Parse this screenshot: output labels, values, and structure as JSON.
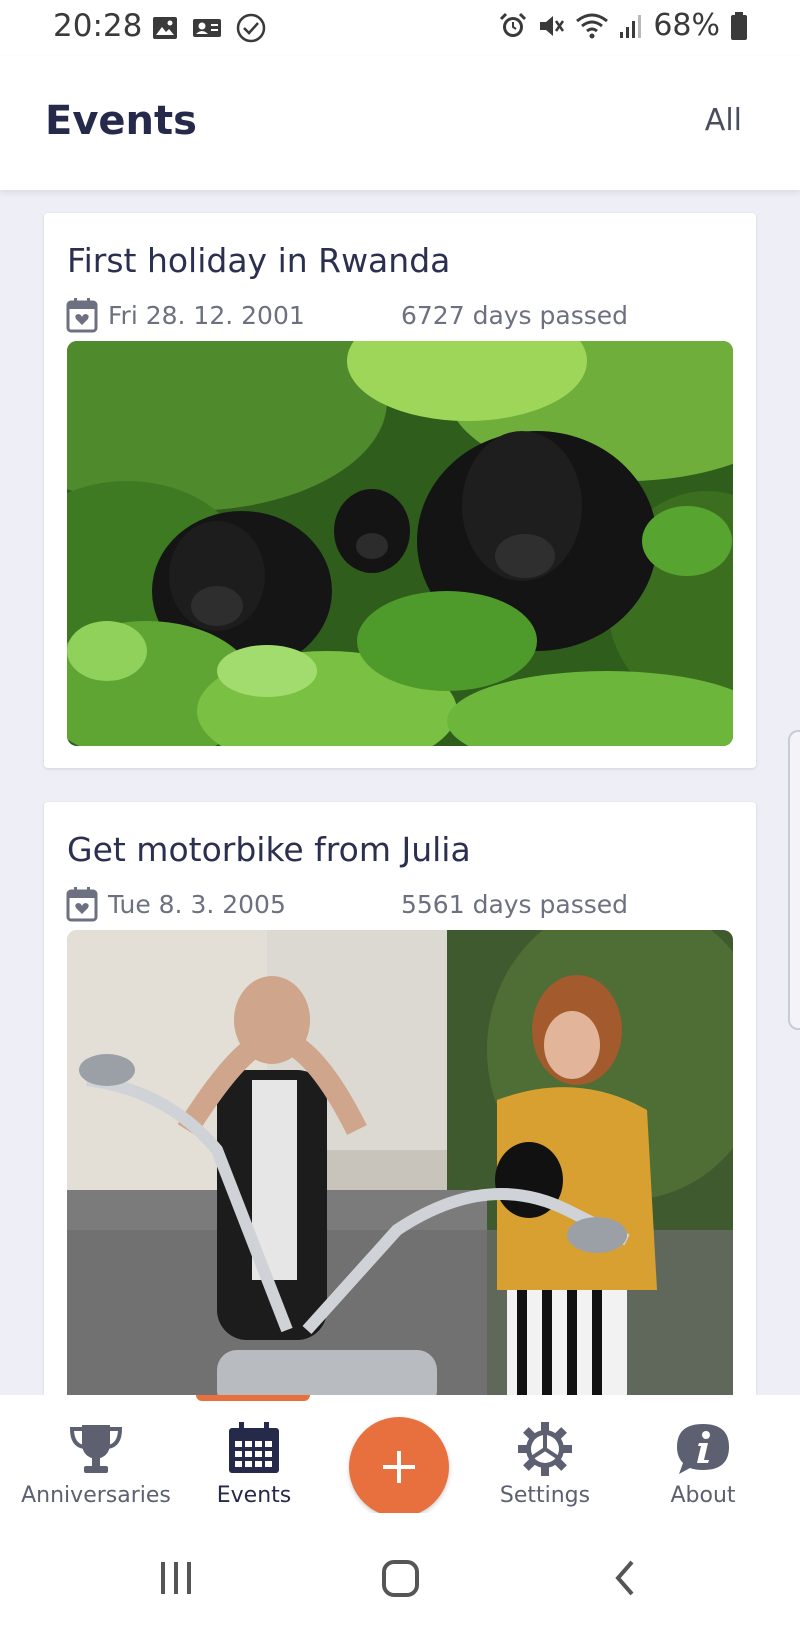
{
  "status_bar": {
    "time": "20:28",
    "battery": "68%",
    "left_icons": [
      "gallery-icon",
      "contact-card-icon",
      "check-circle-icon"
    ],
    "right_icons": [
      "alarm-icon",
      "mute-icon",
      "wifi-icon",
      "signal-icon",
      "battery-icon"
    ]
  },
  "header": {
    "title": "Events",
    "filter_label": "All"
  },
  "events": [
    {
      "title": "First holiday in Rwanda",
      "date": "Fri 28. 12. 2001",
      "days_passed": "6727 days passed",
      "photo_subject": "gorillas in jungle"
    },
    {
      "title": "Get motorbike from Julia",
      "date": "Tue 8. 3. 2005",
      "days_passed": "5561 days passed",
      "photo_subject": "couple with motorbike"
    }
  ],
  "bottom_nav": {
    "items": [
      {
        "label": "Anniversaries",
        "icon": "trophy-icon",
        "active": false
      },
      {
        "label": "Events",
        "icon": "calendar-icon",
        "active": true
      },
      {
        "label": "Settings",
        "icon": "gear-icon",
        "active": false
      },
      {
        "label": "About",
        "icon": "info-icon",
        "active": false
      }
    ],
    "fab_icon": "plus-icon"
  },
  "system_nav": [
    "recents-icon",
    "home-icon",
    "back-icon"
  ],
  "colors": {
    "accent": "#e8703f",
    "title": "#252a4a",
    "background": "#eeeff6"
  }
}
